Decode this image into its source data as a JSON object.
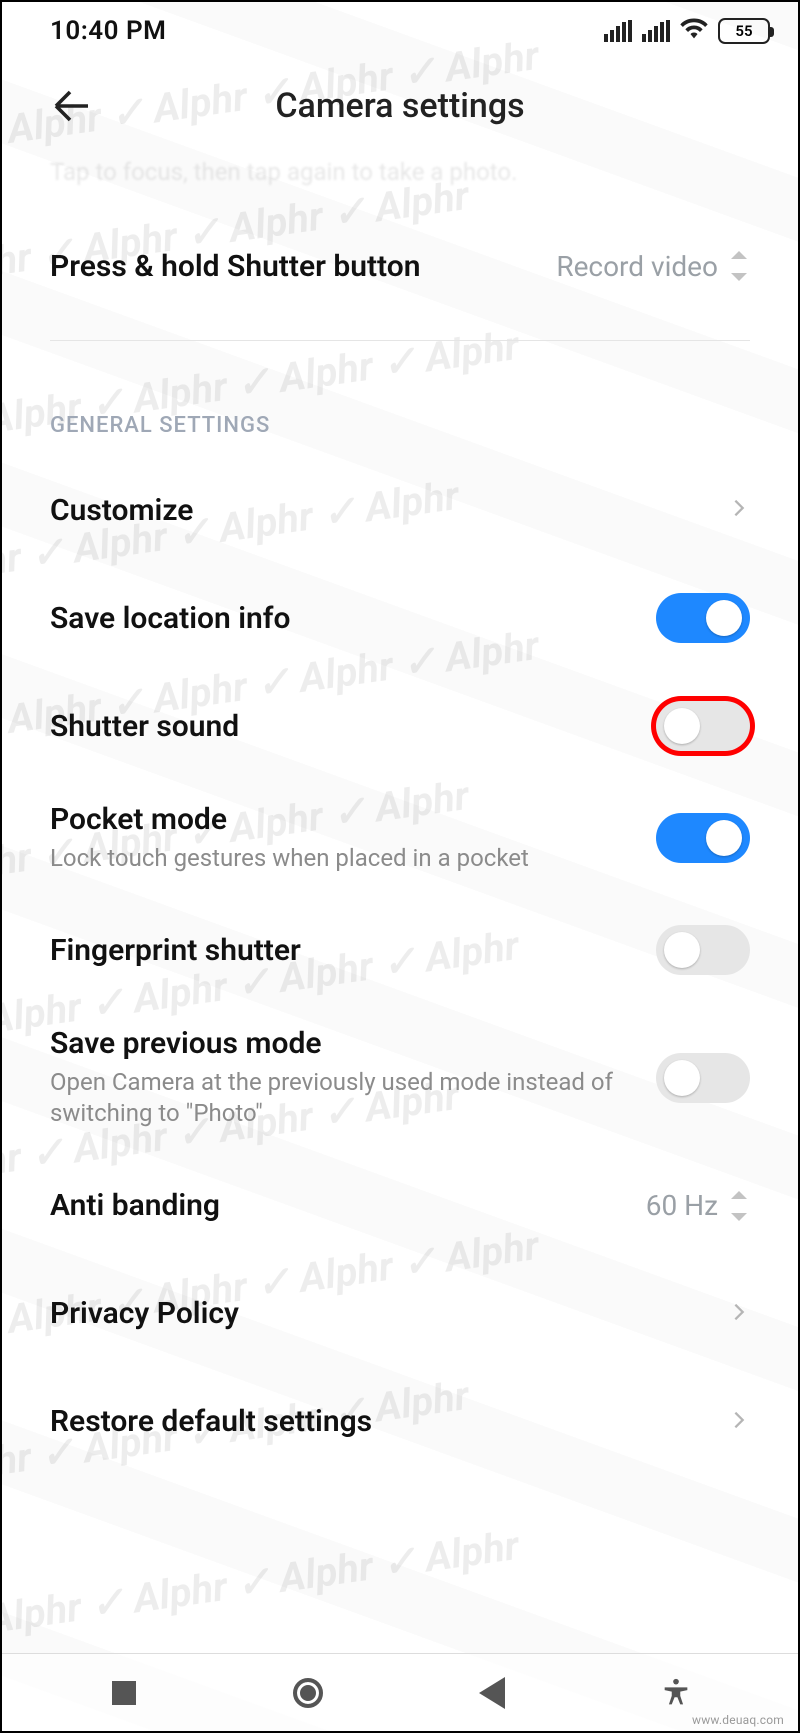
{
  "statusbar": {
    "time": "10:40 PM",
    "battery": "55"
  },
  "header": {
    "title": "Camera settings"
  },
  "top": {
    "faded_sub": "Tap to focus, then tap again to take a photo.",
    "shutter_hold": {
      "label": "Press & hold Shutter button",
      "value": "Record video"
    }
  },
  "section_general": "GENERAL SETTINGS",
  "rows": {
    "customize": {
      "label": "Customize"
    },
    "save_location": {
      "label": "Save location info",
      "on": true
    },
    "shutter_sound": {
      "label": "Shutter sound",
      "on": false
    },
    "pocket_mode": {
      "label": "Pocket mode",
      "sub": "Lock touch gestures when placed in a pocket",
      "on": true
    },
    "fingerprint": {
      "label": "Fingerprint shutter",
      "on": false
    },
    "save_prev": {
      "label": "Save previous mode",
      "sub": "Open Camera at the previously used mode instead of switching to \"Photo\"",
      "on": false
    },
    "anti_banding": {
      "label": "Anti banding",
      "value": "60 Hz"
    },
    "privacy": {
      "label": "Privacy Policy"
    },
    "restore": {
      "label": "Restore default settings"
    }
  },
  "footer": {
    "site": "www.deuaq.com"
  }
}
